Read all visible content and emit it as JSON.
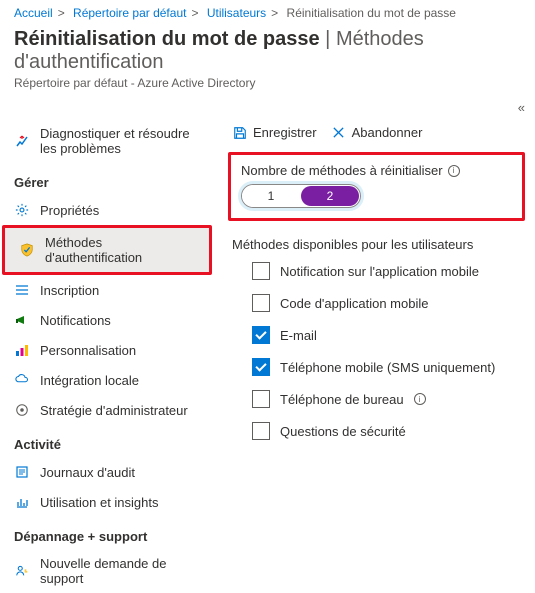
{
  "breadcrumb": [
    "Accueil",
    "Répertoire par défaut",
    "Utilisateurs",
    "Réinitialisation du mot de passe"
  ],
  "title": "Réinitialisation du mot de passe",
  "title_sep": " | ",
  "title_sub": "Méthodes d'authentification",
  "subtitle": "Répertoire par défaut - Azure Active Directory",
  "collapse_glyph": "«",
  "sidebar": {
    "diagnose": "Diagnostiquer et résoudre les problèmes",
    "group_manage": "Gérer",
    "items_manage": [
      "Propriétés",
      "Méthodes d'authentification",
      "Inscription",
      "Notifications",
      "Personnalisation",
      "Intégration locale",
      "Stratégie d'administrateur"
    ],
    "group_activity": "Activité",
    "items_activity": [
      "Journaux d'audit",
      "Utilisation et insights"
    ],
    "group_support": "Dépannage + support",
    "items_support": [
      "Nouvelle demande de support"
    ]
  },
  "toolbar": {
    "save": "Enregistrer",
    "discard": "Abandonner"
  },
  "reset_count": {
    "label": "Nombre de méthodes à réinitialiser",
    "opt1": "1",
    "opt2": "2",
    "selected": "2"
  },
  "methods": {
    "heading": "Méthodes disponibles pour les utilisateurs",
    "list": [
      {
        "label": "Notification sur l'application mobile",
        "checked": false,
        "info": false
      },
      {
        "label": "Code d'application mobile",
        "checked": false,
        "info": false
      },
      {
        "label": "E-mail",
        "checked": true,
        "info": false
      },
      {
        "label": "Téléphone mobile (SMS uniquement)",
        "checked": true,
        "info": false
      },
      {
        "label": "Téléphone de bureau",
        "checked": false,
        "info": true
      },
      {
        "label": "Questions de sécurité",
        "checked": false,
        "info": false
      }
    ]
  }
}
